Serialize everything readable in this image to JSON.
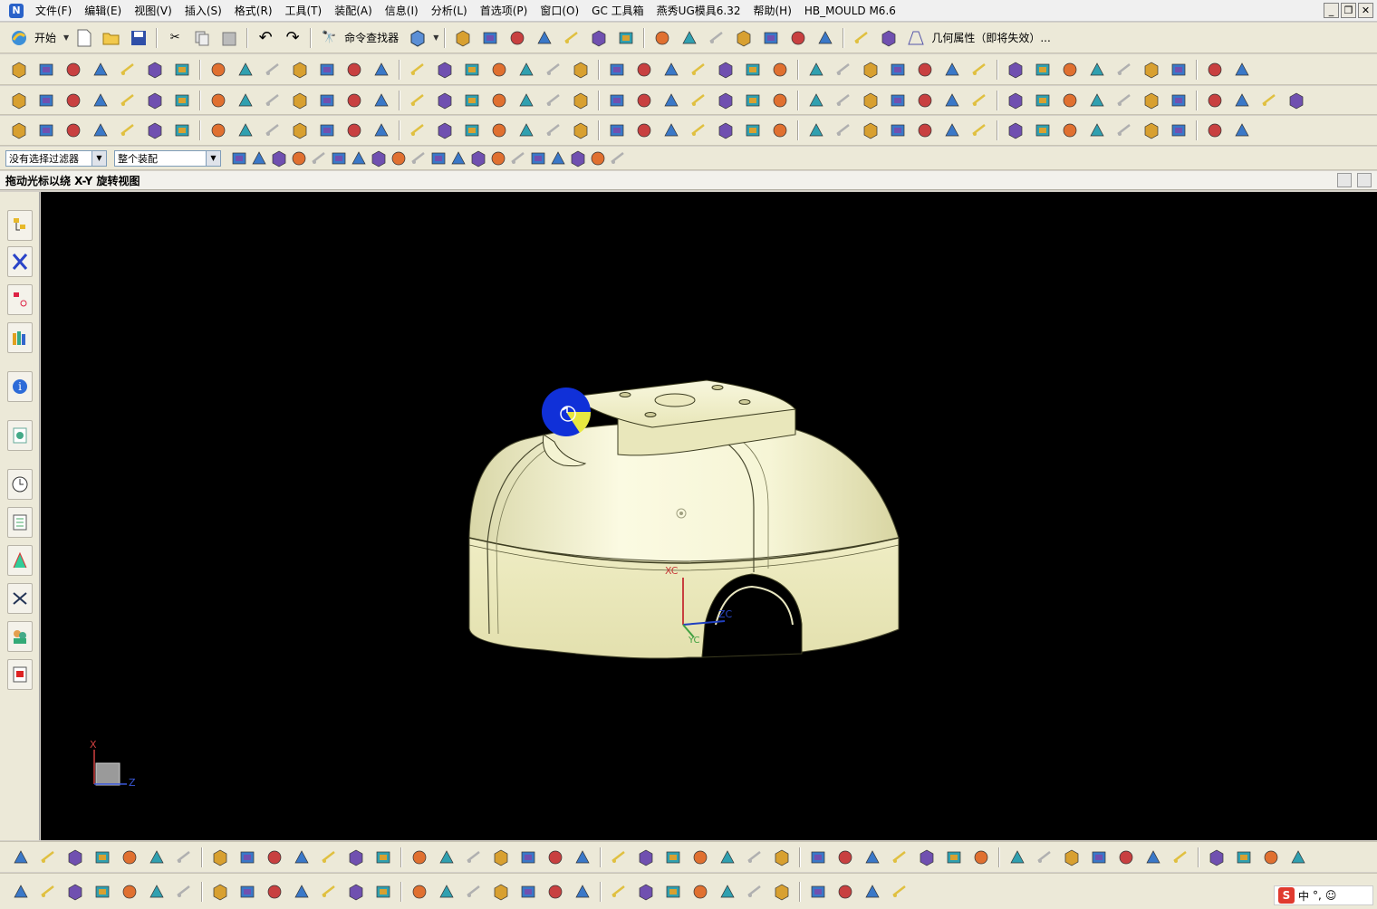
{
  "menubar": {
    "items": [
      "文件(F)",
      "编辑(E)",
      "视图(V)",
      "插入(S)",
      "格式(R)",
      "工具(T)",
      "装配(A)",
      "信息(I)",
      "分析(L)",
      "首选项(P)",
      "窗口(O)",
      "GC 工具箱",
      "燕秀UG模具6.32",
      "帮助(H)",
      "HB_MOULD M6.6"
    ]
  },
  "window_controls": {
    "minimize": "_",
    "restore": "❐",
    "close": "✕"
  },
  "standard_toolbar": {
    "start_label": "开始",
    "command_finder_label": "命令查找器",
    "geometry_props_label": "几何属性（即将失效）..."
  },
  "filter_bar": {
    "type_filter": "没有选择过滤器",
    "scope_filter": "整个装配"
  },
  "status": {
    "prompt": "拖动光标以绕 X-Y 旋转视图"
  },
  "viewport": {
    "background": "#000000",
    "model_color": "#f2f1cc",
    "csys_labels": {
      "xc": "XC",
      "yc": "YC",
      "zc": "ZC"
    },
    "triad_labels": {
      "x": "X",
      "z": "Z"
    }
  },
  "ime": {
    "logo": "S",
    "mode": "中"
  },
  "icons": {
    "row1": [
      "rotate-icon",
      "new-icon",
      "open-icon",
      "save-icon",
      "cut-icon",
      "copy-icon",
      "paste-icon",
      "undo-icon",
      "redo-icon",
      "binoculars-icon",
      "box-icon",
      "edit-icon",
      "transform-icon",
      "fit-icon",
      "shade-icon",
      "cube-icon",
      "layer-icon",
      "view-icon",
      "frame-icon",
      "orient-icon",
      "pin-icon",
      "measure-icon",
      "grid-icon",
      "curve-icon",
      "distance-icon",
      "cross-icon",
      "pyramid-icon",
      "properties-icon",
      "motion-icon"
    ],
    "row2_count": 44,
    "row3_count": 46,
    "row4_count": 44,
    "bottom1_count": 46,
    "bottom2_count": 32
  }
}
